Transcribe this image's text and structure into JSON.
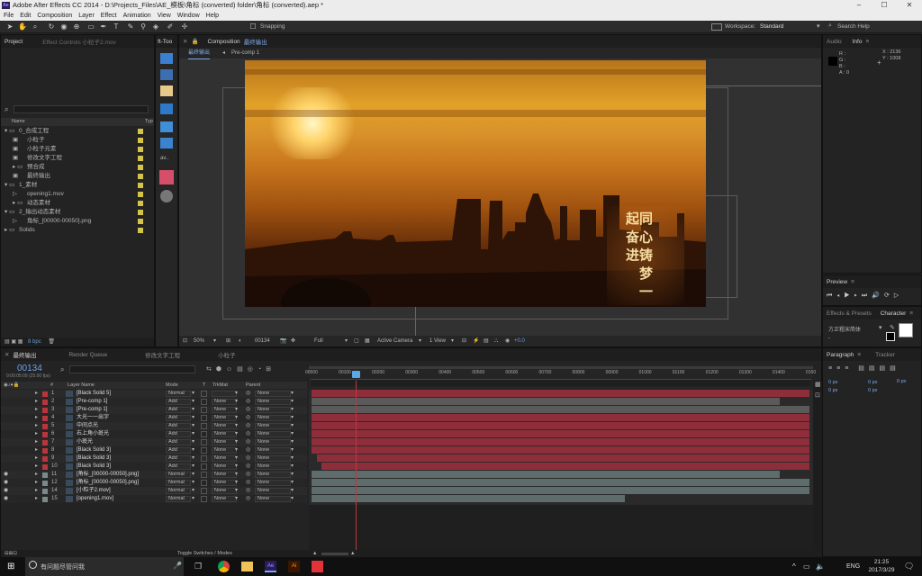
{
  "window": {
    "title": "Adobe After Effects CC 2014 - D:\\Projects_Files\\AE_模板\\角标 (converted) folder\\角标 (converted).aep *",
    "logo": "Ae",
    "minimize": "–",
    "maximize": "☐",
    "close": "✕"
  },
  "menu": [
    "File",
    "Edit",
    "Composition",
    "Layer",
    "Effect",
    "Animation",
    "View",
    "Window",
    "Help"
  ],
  "toolbar": {
    "snapping": "Snapping",
    "workspace_label": "Workspace:",
    "workspace": "Standard",
    "search_placeholder": "Search Help"
  },
  "project": {
    "tab": "Project",
    "effect_tab": "Effect Controls 小粒子2.mov",
    "ft_tab": "ft-Too",
    "name_col": "Name",
    "type_col": "Typ",
    "bpc": "8 bpc",
    "items": [
      {
        "label": "0_合成工程",
        "kind": "folder",
        "indent": 0,
        "open": true,
        "color": "#d4c548"
      },
      {
        "label": "小粒子",
        "kind": "comp",
        "indent": 1,
        "color": "#d4c548"
      },
      {
        "label": "小粒子元素",
        "kind": "comp",
        "indent": 1,
        "color": "#d4c548"
      },
      {
        "label": "修改文字工程",
        "kind": "comp",
        "indent": 1,
        "color": "#d4c548"
      },
      {
        "label": "预合成",
        "kind": "folder",
        "indent": 1,
        "open": false,
        "color": "#d4c548"
      },
      {
        "label": "最终输出",
        "kind": "comp",
        "indent": 1,
        "color": "#d4c548"
      },
      {
        "label": "1_素材",
        "kind": "folder",
        "indent": 0,
        "open": true,
        "color": "#d4c548"
      },
      {
        "label": "opening1.mov",
        "kind": "footage",
        "indent": 1,
        "color": "#d4c548"
      },
      {
        "label": "动态素材",
        "kind": "folder",
        "indent": 1,
        "open": false,
        "color": "#d4c548"
      },
      {
        "label": "2_输出动态素材",
        "kind": "folder",
        "indent": 0,
        "open": true,
        "color": "#d4c548"
      },
      {
        "label": "角标_[00000-00050].png",
        "kind": "footage",
        "indent": 1,
        "color": "#d4c548"
      },
      {
        "label": "Solids",
        "kind": "folder",
        "indent": 0,
        "open": false,
        "color": "#d4c548"
      }
    ]
  },
  "comp": {
    "tab": "Composition",
    "tab_name": "最终输出",
    "crumb1": "最终输出",
    "crumb2": "Pre-comp 1",
    "zoom": "50%",
    "time": "00134",
    "res": "Full",
    "camera": "Active Camera",
    "view": "1 View",
    "exposure": "+0.0",
    "calligraphy": "同 心 铸 梦 一 起 奋 进"
  },
  "info": {
    "audio_tab": "Audio",
    "info_tab": "Info",
    "r": "R :",
    "g": "G :",
    "b": "B :",
    "a": "A : 0",
    "x": "X : 2136",
    "y": "Y : 1008"
  },
  "preview": {
    "tab": "Preview"
  },
  "effects": {
    "tab": "Effects & Presets",
    "char_tab": "Character",
    "font": "方正粗宋简体",
    "style": "-"
  },
  "paragraph": {
    "tab": "Paragraph",
    "tracker_tab": "Tracker",
    "v1": "0 px",
    "v2": "0 px",
    "v3": "0 px",
    "v4": "0 px",
    "v5": "0 px"
  },
  "timeline": {
    "tabs": [
      "最终输出",
      "Render Queue",
      "修改文字工程",
      "小粒子"
    ],
    "timecode": "00134",
    "timecode_sub": "0:00:05:09 (25.00 fps)",
    "toggle": "Toggle Switches / Modes",
    "cols": {
      "num": "#",
      "name": "Layer Name",
      "mode": "Mode",
      "t": "T",
      "trk": "TrkMat",
      "parent": "Parent"
    },
    "ruler": [
      "00000",
      "00100",
      "00200",
      "00300",
      "00400",
      "00500",
      "00600",
      "00700",
      "00800",
      "00900",
      "01000",
      "01100",
      "01200",
      "01300",
      "01400",
      "0150"
    ],
    "layers": [
      {
        "n": "1",
        "name": "[Black Solid 5]",
        "mode": "Normal",
        "trk": "",
        "parent": "None",
        "color": "#b8353e",
        "bar": "#8f2e3b",
        "x0": 0,
        "x1": 1,
        "eye": false
      },
      {
        "n": "2",
        "name": "[Pre-comp 1]",
        "mode": "Add",
        "trk": "None",
        "parent": "None",
        "color": "#b8353e",
        "bar": "#5a5a5a",
        "x0": 0,
        "x1": 0.94,
        "eye": false
      },
      {
        "n": "3",
        "name": "[Pre-comp 1]",
        "mode": "Add",
        "trk": "None",
        "parent": "None",
        "color": "#b8353e",
        "bar": "#5a5a5a",
        "x0": 0,
        "x1": 1,
        "eye": false
      },
      {
        "n": "4",
        "name": "大光一一出字",
        "mode": "Add",
        "trk": "None",
        "parent": "None",
        "color": "#b8353e",
        "bar": "#8f2e3b",
        "x0": 0,
        "x1": 1,
        "eye": false
      },
      {
        "n": "5",
        "name": "中间点光",
        "mode": "Add",
        "trk": "None",
        "parent": "None",
        "color": "#b8353e",
        "bar": "#8f2e3b",
        "x0": 0,
        "x1": 1,
        "eye": false
      },
      {
        "n": "6",
        "name": "右上角小斑光",
        "mode": "Add",
        "trk": "None",
        "parent": "None",
        "color": "#b8353e",
        "bar": "#8f2e3b",
        "x0": 0,
        "x1": 1,
        "eye": false
      },
      {
        "n": "7",
        "name": "小斑光",
        "mode": "Add",
        "trk": "None",
        "parent": "None",
        "color": "#b8353e",
        "bar": "#8f2e3b",
        "x0": 0,
        "x1": 1,
        "eye": false
      },
      {
        "n": "8",
        "name": "[Black Solid 3]",
        "mode": "Add",
        "trk": "None",
        "parent": "None",
        "color": "#b8353e",
        "bar": "#8f2e3b",
        "x0": 0,
        "x1": 1,
        "eye": false
      },
      {
        "n": "9",
        "name": "[Black Solid 3]",
        "mode": "Add",
        "trk": "None",
        "parent": "None",
        "color": "#b8353e",
        "bar": "#8f2e3b",
        "x0": 0.01,
        "x1": 1,
        "eye": false
      },
      {
        "n": "10",
        "name": "[Black Solid 3]",
        "mode": "Add",
        "trk": "None",
        "parent": "None",
        "color": "#b8353e",
        "bar": "#8f2e3b",
        "x0": 0.02,
        "x1": 1,
        "eye": false
      },
      {
        "n": "11",
        "name": "[角标_[00000-00050].png]",
        "mode": "Normal",
        "trk": "None",
        "parent": "None",
        "color": "#7a8a8a",
        "bar": "#5e6c6c",
        "x0": 0,
        "x1": 0.94,
        "eye": true
      },
      {
        "n": "12",
        "name": "[角标_[00000-00050].png]",
        "mode": "Normal",
        "trk": "None",
        "parent": "None",
        "color": "#7a8a8a",
        "bar": "#5e6c6c",
        "x0": 0,
        "x1": 1,
        "eye": true
      },
      {
        "n": "14",
        "name": "[小粒子2.mov]",
        "mode": "Normal",
        "trk": "None",
        "parent": "None",
        "color": "#7a8a8a",
        "bar": "#5e6c6c",
        "x0": 0,
        "x1": 1,
        "eye": true
      },
      {
        "n": "15",
        "name": "[opening1.mov]",
        "mode": "Normal",
        "trk": "None",
        "parent": "None",
        "color": "#7a8a8a",
        "bar": "#5e6c6c",
        "x0": 0,
        "x1": 0.63,
        "eye": true
      }
    ]
  },
  "taskbar": {
    "search": "有问题尽管问我",
    "lang": "ENG",
    "time": "21:25",
    "date": "2017/3/29",
    "ae": "Ae",
    "ai": "Ai"
  }
}
